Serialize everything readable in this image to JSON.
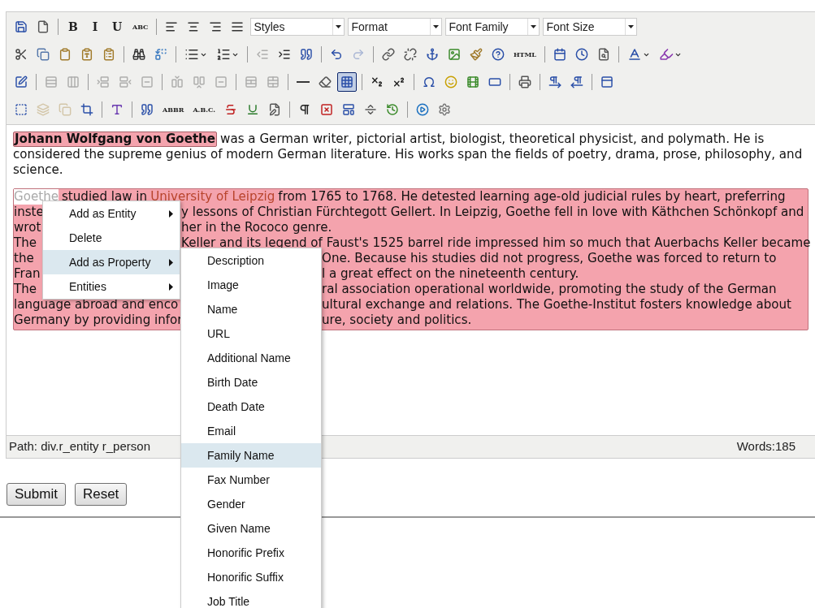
{
  "toolbar": {
    "rows": [
      [
        {
          "kind": "button",
          "disabled": false,
          "pressed": false
        },
        {
          "kind": "button",
          "disabled": false,
          "pressed": false
        },
        {
          "kind": "separator"
        },
        {
          "kind": "text",
          "text": "B",
          "disabled": false,
          "pressed": false
        },
        {
          "kind": "text",
          "text": "I",
          "disabled": false,
          "pressed": false
        },
        {
          "kind": "text",
          "text": "U",
          "disabled": false,
          "pressed": false
        },
        {
          "kind": "text",
          "text": "ABC",
          "disabled": false,
          "pressed": false
        },
        {
          "kind": "separator"
        },
        {
          "kind": "button",
          "disabled": false,
          "pressed": false
        },
        {
          "kind": "button",
          "disabled": false,
          "pressed": false
        },
        {
          "kind": "button",
          "disabled": false,
          "pressed": false
        },
        {
          "kind": "button",
          "disabled": false,
          "pressed": false
        },
        {
          "kind": "select",
          "text": "Styles"
        },
        {
          "kind": "select",
          "text": "Format"
        },
        {
          "kind": "select",
          "text": "Font Family"
        },
        {
          "kind": "select",
          "text": "Font Size"
        }
      ],
      [
        {
          "kind": "button",
          "disabled": false,
          "pressed": false
        },
        {
          "kind": "button",
          "disabled": false,
          "pressed": false
        },
        {
          "kind": "button",
          "disabled": false,
          "pressed": false
        },
        {
          "kind": "button",
          "disabled": false,
          "pressed": false
        },
        {
          "kind": "button",
          "disabled": false,
          "pressed": false
        },
        {
          "kind": "separator"
        },
        {
          "kind": "button",
          "disabled": false,
          "pressed": false
        },
        {
          "kind": "button",
          "disabled": false,
          "pressed": false
        },
        {
          "kind": "separator"
        },
        {
          "kind": "split",
          "disabled": false,
          "pressed": false
        },
        {
          "kind": "split",
          "disabled": false,
          "pressed": false
        },
        {
          "kind": "separator"
        },
        {
          "kind": "button",
          "disabled": true,
          "pressed": false
        },
        {
          "kind": "button",
          "disabled": false,
          "pressed": false
        },
        {
          "kind": "button",
          "disabled": false,
          "pressed": false
        },
        {
          "kind": "separator"
        },
        {
          "kind": "button",
          "disabled": false,
          "pressed": false
        },
        {
          "kind": "button",
          "disabled": true,
          "pressed": false
        },
        {
          "kind": "separator"
        },
        {
          "kind": "button",
          "disabled": false,
          "pressed": false
        },
        {
          "kind": "button",
          "disabled": false,
          "pressed": false
        },
        {
          "kind": "button",
          "disabled": false,
          "pressed": false
        },
        {
          "kind": "button",
          "disabled": false,
          "pressed": false
        },
        {
          "kind": "button",
          "disabled": false,
          "pressed": false
        },
        {
          "kind": "button",
          "disabled": false,
          "pressed": false
        },
        {
          "kind": "text",
          "text": "HTML",
          "disabled": false,
          "pressed": false
        },
        {
          "kind": "separator"
        },
        {
          "kind": "button",
          "disabled": false,
          "pressed": false
        },
        {
          "kind": "button",
          "disabled": false,
          "pressed": false
        },
        {
          "kind": "button",
          "disabled": false,
          "pressed": false
        },
        {
          "kind": "separator"
        },
        {
          "kind": "split",
          "disabled": false,
          "pressed": false
        },
        {
          "kind": "split",
          "disabled": false,
          "pressed": false
        }
      ],
      [
        {
          "kind": "button",
          "disabled": false,
          "pressed": false
        },
        {
          "kind": "separator"
        },
        {
          "kind": "button",
          "disabled": true,
          "pressed": false
        },
        {
          "kind": "button",
          "disabled": true,
          "pressed": false
        },
        {
          "kind": "separator"
        },
        {
          "kind": "button",
          "disabled": true,
          "pressed": false
        },
        {
          "kind": "button",
          "disabled": true,
          "pressed": false
        },
        {
          "kind": "button",
          "disabled": true,
          "pressed": false
        },
        {
          "kind": "separator"
        },
        {
          "kind": "button",
          "disabled": true,
          "pressed": false
        },
        {
          "kind": "button",
          "disabled": true,
          "pressed": false
        },
        {
          "kind": "button",
          "disabled": true,
          "pressed": false
        },
        {
          "kind": "separator"
        },
        {
          "kind": "button",
          "disabled": true,
          "pressed": false
        },
        {
          "kind": "button",
          "disabled": true,
          "pressed": false
        },
        {
          "kind": "separator"
        },
        {
          "kind": "button",
          "disabled": false,
          "pressed": false
        },
        {
          "kind": "button",
          "disabled": false,
          "pressed": false
        },
        {
          "kind": "button",
          "disabled": false,
          "pressed": true
        },
        {
          "kind": "separator"
        },
        {
          "kind": "button",
          "disabled": false,
          "pressed": false
        },
        {
          "kind": "button",
          "disabled": false,
          "pressed": false
        },
        {
          "kind": "separator"
        },
        {
          "kind": "button",
          "disabled": false,
          "pressed": false
        },
        {
          "kind": "button",
          "disabled": false,
          "pressed": false
        },
        {
          "kind": "button",
          "disabled": false,
          "pressed": false
        },
        {
          "kind": "button",
          "disabled": false,
          "pressed": false
        },
        {
          "kind": "separator"
        },
        {
          "kind": "button",
          "disabled": false,
          "pressed": false
        },
        {
          "kind": "separator"
        },
        {
          "kind": "button",
          "disabled": false,
          "pressed": false
        },
        {
          "kind": "button",
          "disabled": false,
          "pressed": false
        },
        {
          "kind": "separator"
        },
        {
          "kind": "button",
          "disabled": false,
          "pressed": false
        }
      ],
      [
        {
          "kind": "button",
          "disabled": false,
          "pressed": false
        },
        {
          "kind": "button",
          "disabled": true,
          "pressed": false
        },
        {
          "kind": "button",
          "disabled": true,
          "pressed": false
        },
        {
          "kind": "button",
          "disabled": false,
          "pressed": false
        },
        {
          "kind": "separator"
        },
        {
          "kind": "button",
          "disabled": false,
          "pressed": false
        },
        {
          "kind": "separator"
        },
        {
          "kind": "button",
          "disabled": false,
          "pressed": false
        },
        {
          "kind": "text",
          "text": "ABBR",
          "disabled": false,
          "pressed": false
        },
        {
          "kind": "text",
          "text": "A.B.C.",
          "disabled": false,
          "pressed": false
        },
        {
          "kind": "button",
          "disabled": false,
          "pressed": false
        },
        {
          "kind": "button",
          "disabled": false,
          "pressed": false
        },
        {
          "kind": "button",
          "disabled": false,
          "pressed": false
        },
        {
          "kind": "separator"
        },
        {
          "kind": "button",
          "disabled": false,
          "pressed": false
        },
        {
          "kind": "button",
          "disabled": false,
          "pressed": false
        },
        {
          "kind": "button",
          "disabled": false,
          "pressed": false
        },
        {
          "kind": "button",
          "disabled": false,
          "pressed": false
        },
        {
          "kind": "button",
          "disabled": false,
          "pressed": false
        },
        {
          "kind": "separator"
        },
        {
          "kind": "button",
          "disabled": false,
          "pressed": false
        },
        {
          "kind": "button",
          "disabled": false,
          "pressed": false
        }
      ]
    ]
  },
  "content": {
    "paragraph_1": {
      "entity": "Johann Wolfgang von Goethe",
      "lines": [
        "was a German writer, pictorial artist, biologist, theoretical physicist, and polymath. He is",
        "considered the supreme genius of modern German literature. His works span the fields of poetry, drama, prose, philosophy, and",
        "science."
      ]
    },
    "paragraph_2": {
      "first_line": {
        "selection": "Goethe",
        "before": "studied law in",
        "place": "University of Leipzig",
        "after": "from 1765 to 1768. He detested learning age-old judicial rules by heart, preferring"
      },
      "lines": [
        {
          "left": "inste",
          "right": "y lessons of Christian Fürchtegott Gellert. In Leipzig, Goethe fell in love with Käthchen Schönkopf and"
        },
        {
          "left": "wrot",
          "right": "her in the Rococo genre."
        },
        {
          "left": "The",
          "right": "Keller and its legend of Faust's 1525 barrel ride impressed him so much that Auerbachs Keller became"
        },
        {
          "left": "the",
          "right": "One. Because his studies did not progress, Goethe was forced to return to"
        },
        {
          "left": "Fran",
          "right": "l a great effect on the nineteenth century."
        },
        {
          "left": "The",
          "right": "ral association operational worldwide, promoting the study of the German"
        },
        {
          "left": "language abroad and enco",
          "right": "ultural exchange and relations. The Goethe-Institut fosters knowledge about"
        },
        {
          "left": "Germany by providing infor",
          "right": "ure, society and politics."
        }
      ]
    }
  },
  "status_bar": {
    "path": "Path: div.r_entity r_person",
    "words": "Words:185"
  },
  "buttons": [
    "Submit",
    "Reset"
  ],
  "context_menu": {
    "items": [
      {
        "label": "Add as Entity",
        "submenu": true,
        "selected": false
      },
      {
        "label": "Delete",
        "submenu": false,
        "selected": false
      },
      {
        "label": "Add as Property",
        "submenu": true,
        "selected": true
      },
      {
        "label": "Entities",
        "submenu": true,
        "selected": false
      }
    ]
  },
  "submenu": {
    "items": [
      {
        "label": "Description",
        "selected": false
      },
      {
        "label": "Image",
        "selected": false
      },
      {
        "label": "Name",
        "selected": false
      },
      {
        "label": "URL",
        "selected": false
      },
      {
        "label": "Additional Name",
        "selected": false
      },
      {
        "label": "Birth Date",
        "selected": false
      },
      {
        "label": "Death Date",
        "selected": false
      },
      {
        "label": "Email",
        "selected": false
      },
      {
        "label": "Family Name",
        "selected": true
      },
      {
        "label": "Fax Number",
        "selected": false
      },
      {
        "label": "Gender",
        "selected": false
      },
      {
        "label": "Given Name",
        "selected": false
      },
      {
        "label": "Honorific Prefix",
        "selected": false
      },
      {
        "label": "Honorific Suffix",
        "selected": false
      },
      {
        "label": "Job Title",
        "selected": false
      }
    ]
  }
}
